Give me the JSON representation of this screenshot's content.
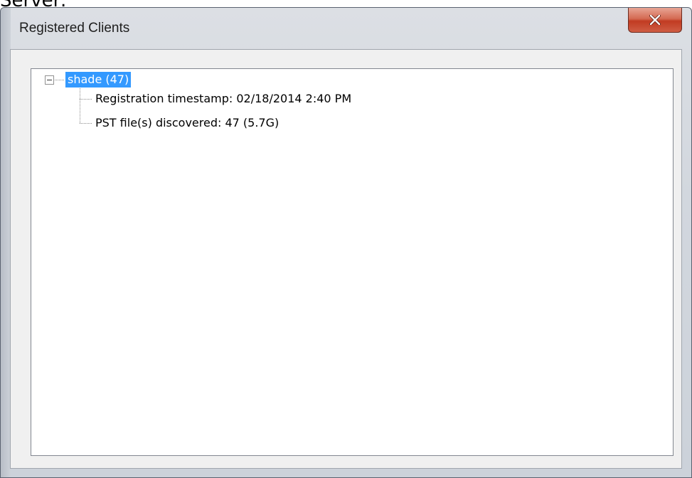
{
  "background_text": "Server:",
  "window": {
    "title": "Registered Clients",
    "close_label": "Close"
  },
  "tree": {
    "root": {
      "label": "shade (47)",
      "expanded": true,
      "selected": true
    },
    "children": [
      {
        "label": "Registration timestamp: 02/18/2014 2:40 PM"
      },
      {
        "label": "PST file(s) discovered: 47 (5.7G)"
      }
    ]
  },
  "colors": {
    "selection": "#3399ff",
    "close_button": "#c13b22"
  }
}
